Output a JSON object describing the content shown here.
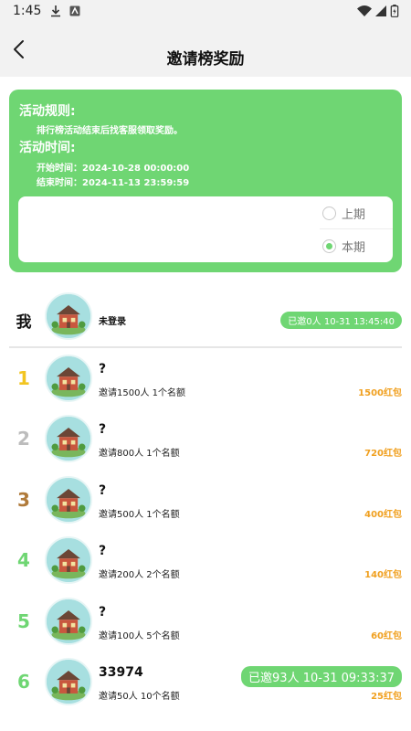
{
  "status_bar": {
    "time": "1:45"
  },
  "header": {
    "title": "邀请榜奖励"
  },
  "rules": {
    "rules_title": "活动规则:",
    "rules_text": "排行榜活动结束后找客服领取奖励。",
    "time_title": "活动时间:",
    "start_time": "开始时间：2024-10-28 00:00:00",
    "end_time": "结束时间：2024-11-13 23:59:59",
    "periods": [
      {
        "label": "上期",
        "selected": false
      },
      {
        "label": "本期",
        "selected": true
      }
    ]
  },
  "me": {
    "rank_label": "我",
    "name": "未登录",
    "invite_status": "已邀0人 10-31 13:45:40"
  },
  "leaderboard": [
    {
      "rank": "1",
      "rank_color": "#f2c521",
      "name": "?",
      "quota": "邀请1500人 1个名额",
      "prize": "1500红包"
    },
    {
      "rank": "2",
      "rank_color": "#bcbcbc",
      "name": "?",
      "quota": "邀请800人 1个名额",
      "prize": "720红包"
    },
    {
      "rank": "3",
      "rank_color": "#b07a3a",
      "name": "?",
      "quota": "邀请500人 1个名额",
      "prize": "400红包"
    },
    {
      "rank": "4",
      "rank_color": "#6fd673",
      "name": "?",
      "quota": "邀请200人 2个名额",
      "prize": "140红包"
    },
    {
      "rank": "5",
      "rank_color": "#6fd673",
      "name": "?",
      "quota": "邀请100人 5个名额",
      "prize": "60红包"
    },
    {
      "rank": "6",
      "rank_color": "#6fd673",
      "name": "33974",
      "quota": "邀请50人 10个名额",
      "prize": "25红包",
      "invite_status": "已邀93人 10-31 09:33:37"
    }
  ],
  "colors": {
    "accent_green": "#6fd673",
    "prize_orange": "#f0a020",
    "header_bg": "#f2f2f2"
  },
  "icons": {
    "back": "chevron-left-icon",
    "download": "download-icon",
    "notification": "app-notification-icon",
    "wifi": "wifi-icon",
    "signal": "signal-icon",
    "battery": "battery-icon",
    "avatar": "house-avatar-icon"
  }
}
